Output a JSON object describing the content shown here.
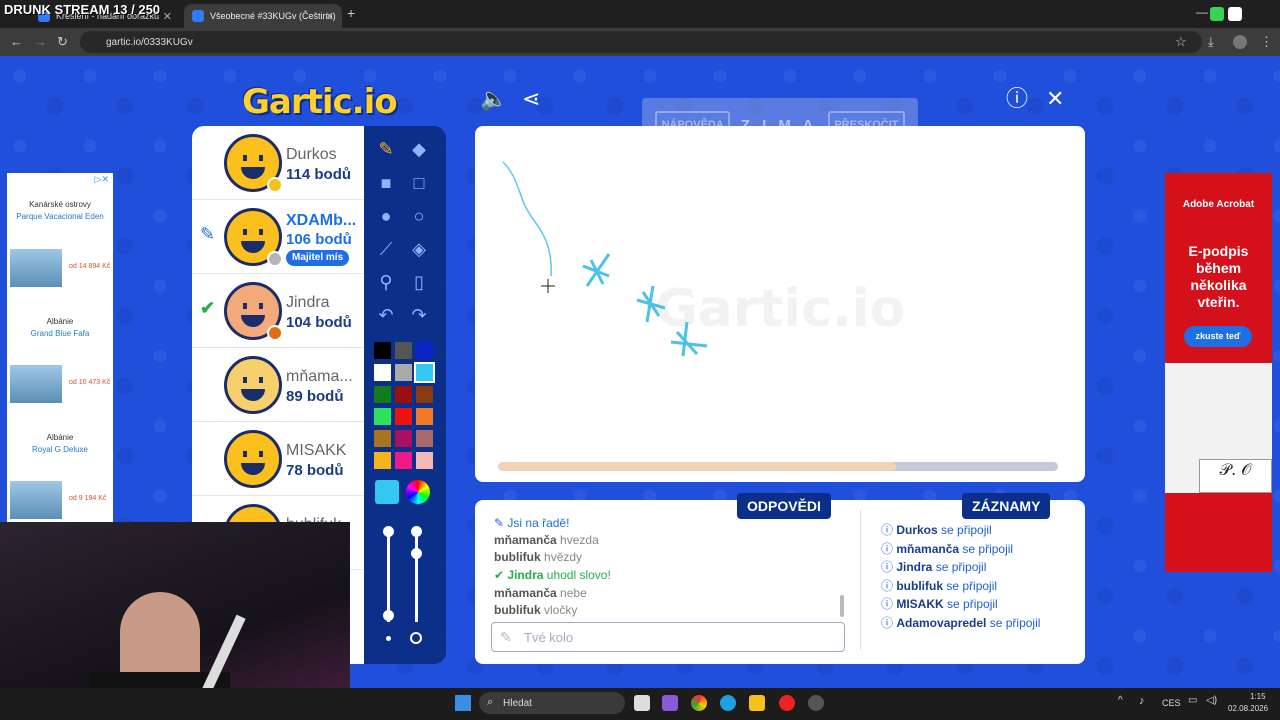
{
  "stream_title": "DRUNK STREAM 13 / 250",
  "browser": {
    "tabs": [
      {
        "label": "Kreslení - hádání obrázků"
      },
      {
        "label": "Všeobecné #33KUGv (Čeština)"
      }
    ],
    "url": "gartic.io/0333KUGv"
  },
  "app": {
    "logo": "Gartic.io",
    "hint_button": "NÁPOVĚDA",
    "word": "Z I M A",
    "skip_button": "PŘESKOČIT"
  },
  "players": [
    {
      "name": "Durkos",
      "points": "114 bodů",
      "dot_color": "#f5c21b"
    },
    {
      "name": "XDAMb...",
      "points": "106 bodů",
      "dot_color": "#b5b5b5",
      "badge": "Majitel mís",
      "drawing": true
    },
    {
      "name": "Jindra",
      "points": "104 bodů",
      "dot_color": "#e36b10",
      "guessed": true
    },
    {
      "name": "mňama...",
      "points": "89 bodů"
    },
    {
      "name": "MISAKK",
      "points": "78 bodů"
    },
    {
      "name": "bublifuk",
      "points": ""
    }
  ],
  "palette": [
    "#000000",
    "#555555",
    "#0a24c8",
    "#ffffff",
    "#aaaaaa",
    "#33c8f0",
    "#147a1e",
    "#9a1010",
    "#8a3a10",
    "#2ee05a",
    "#ee1111",
    "#f07a2a",
    "#a87420",
    "#a81060",
    "#a86a6a",
    "#f5b51a",
    "#ee1a8a",
    "#f5b8b8"
  ],
  "selected_color": "#33c8f0",
  "round_progress": 0.71,
  "answers": {
    "label": "ODPOVĚDI",
    "messages": [
      {
        "user": "",
        "text": "Jsi na řadě!"
      },
      {
        "user": "mňamanča",
        "text": "hvezda"
      },
      {
        "user": "bublifuk",
        "text": "hvězdy"
      },
      {
        "user": "Jindra",
        "text": "uhodl slovo!",
        "correct": true
      },
      {
        "user": "mňamanča",
        "text": "nebe"
      },
      {
        "user": "bublifuk",
        "text": "vločky"
      }
    ],
    "placeholder": "Tvé kolo"
  },
  "records": {
    "label": "ZÁZNAMY",
    "items": [
      {
        "user": "Durkos",
        "text": "se připojil"
      },
      {
        "user": "mňamanča",
        "text": "se připojil"
      },
      {
        "user": "Jindra",
        "text": "se připojil"
      },
      {
        "user": "bublifuk",
        "text": "se připojil"
      },
      {
        "user": "MISAKK",
        "text": "se připojil"
      },
      {
        "user": "Adamovapredel",
        "text": "se připojil"
      }
    ]
  },
  "ad_left": [
    {
      "place": "Kanárské ostrovy",
      "hotel": "Parque Vacacional Eden",
      "price": "od 14 894 Kč"
    },
    {
      "place": "Albánie",
      "hotel": "Grand Blue Fafa",
      "price": "od 10 473 Kč"
    },
    {
      "place": "Albánie",
      "hotel": "Royal G Deluxe",
      "price": "od 9 194 Kč"
    }
  ],
  "ad_right": {
    "brand": "Adobe Acrobat",
    "headline": "E-podpis během několika vteřin.",
    "cta": "zkuste teď"
  },
  "taskbar": {
    "search": "Hledat",
    "lang": "CES",
    "time": "1:15",
    "date": "02.08.2026"
  }
}
